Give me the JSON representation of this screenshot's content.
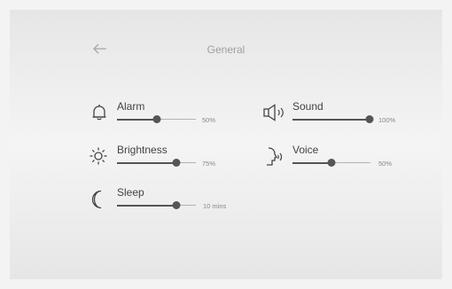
{
  "header": {
    "title": "General",
    "back_icon": "arrow-left-icon"
  },
  "settings": [
    {
      "id": "alarm",
      "label": "Alarm",
      "icon": "bell-icon",
      "value_text": "50%",
      "level": 0.5
    },
    {
      "id": "sound",
      "label": "Sound",
      "icon": "speaker-icon",
      "value_text": "100%",
      "level": 1.0
    },
    {
      "id": "brightness",
      "label": "Brightness",
      "icon": "sun-icon",
      "value_text": "75%",
      "level": 0.75
    },
    {
      "id": "voice",
      "label": "Voice",
      "icon": "voice-icon",
      "value_text": "50%",
      "level": 0.5
    },
    {
      "id": "sleep",
      "label": "Sleep",
      "icon": "moon-icon",
      "value_text": "10 mins",
      "level": 0.75
    }
  ],
  "colors": {
    "accent": "#555555",
    "track": "#b3b3b3",
    "text": "#444444",
    "muted": "#9f9f9f"
  }
}
